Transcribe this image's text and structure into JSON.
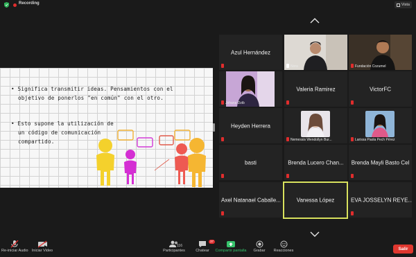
{
  "topbar": {
    "recording_label": "Recording",
    "view_label": "Vista"
  },
  "slide": {
    "lines": [
      "• Significa transmitir ideas. Pensamientos con el",
      "objetivo de ponerlos \"en común\" con el otro.",
      "• Esto supone la utilización de",
      "un código de comunicación",
      "compartido."
    ]
  },
  "gallery": {
    "tiles": [
      {
        "name": "Azul Hernández"
      },
      {
        "name": "Nora"
      },
      {
        "name": "Fundación Cozumel"
      },
      {
        "name": "Johana Dzib"
      },
      {
        "name": "Valeria Ramirez"
      },
      {
        "name": "VictorFC"
      },
      {
        "name": "Heyden Herrera"
      },
      {
        "name": "Nemessis Wendollyn Bur..."
      },
      {
        "name": "Larissa Paola Pech Pérez"
      },
      {
        "name": "basti"
      },
      {
        "name": "Brenda Lucero Chan..."
      },
      {
        "name": "Brenda Mayli Basto Cel"
      },
      {
        "name": "Axel Natanael Caballe..."
      },
      {
        "name": "Vanessa López"
      },
      {
        "name": "EVA JOSSELYN REYE..."
      }
    ]
  },
  "toolbar": {
    "reiniciar_audio": "Re-iniciar Audio",
    "iniciar_video": "Iniciar Video",
    "participantes": "Participantes",
    "participant_count": "116",
    "chatear": "Chatear",
    "chat_badge": "37",
    "compartir": "Compartir pantalla",
    "grabar": "Grabar",
    "reacciones": "Reacciones",
    "salir": "Salir"
  },
  "colors": {
    "accent_green": "#36c26b",
    "leave_red": "#e0372f",
    "active_speaker": "#d9e25e"
  }
}
